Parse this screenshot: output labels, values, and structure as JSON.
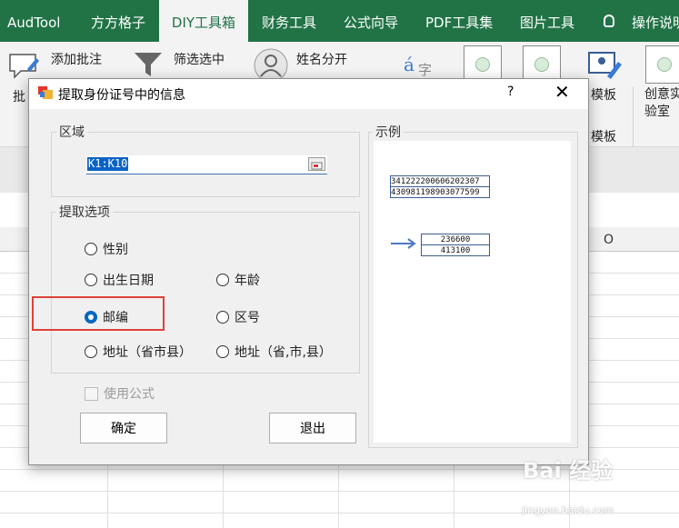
{
  "tabs": [
    {
      "label": "AudTool",
      "active": false
    },
    {
      "label": "方方格子",
      "active": false
    },
    {
      "label": "DIY工具箱",
      "active": true
    },
    {
      "label": "财务工具",
      "active": false
    },
    {
      "label": "公式向导",
      "active": false
    },
    {
      "label": "PDF工具集",
      "active": false
    },
    {
      "label": "图片工具",
      "active": false
    },
    {
      "label": "操作说明",
      "active": false
    }
  ],
  "ribbon": {
    "add_comment": "添加批注",
    "comment_partial": "批",
    "filter_selected": "筛选选中",
    "split_name": "姓名分开",
    "template": "模板",
    "template2": "模板",
    "creative_lab_1": "创意实",
    "creative_lab_2": "验室"
  },
  "sheet": {
    "col_o": "O"
  },
  "dialog": {
    "title": "提取身份证号中的信息",
    "help": "?",
    "close": "✕",
    "region_label": "区域",
    "range_value": "K1:K10",
    "options_label": "提取选项",
    "options": {
      "gender": "性别",
      "birthdate": "出生日期",
      "age": "年龄",
      "postcode": "邮编",
      "area_code": "区号",
      "address_short": "地址（省市县）",
      "address_comma": "地址（省,市,县）"
    },
    "selected_option": "postcode",
    "use_formula": "使用公式",
    "ok_button": "确定",
    "exit_button": "退出",
    "example_label": "示例",
    "example_ids": [
      "341222200606202307",
      "430981198903077599"
    ],
    "example_results": [
      "236600",
      "413100"
    ]
  },
  "watermark": {
    "brand": "Bai 经验",
    "url": "jingyan.baidu.com"
  },
  "colors": {
    "excel_green": "#217346",
    "highlight_red": "#e0413b",
    "selection_blue": "#0a63c4"
  }
}
